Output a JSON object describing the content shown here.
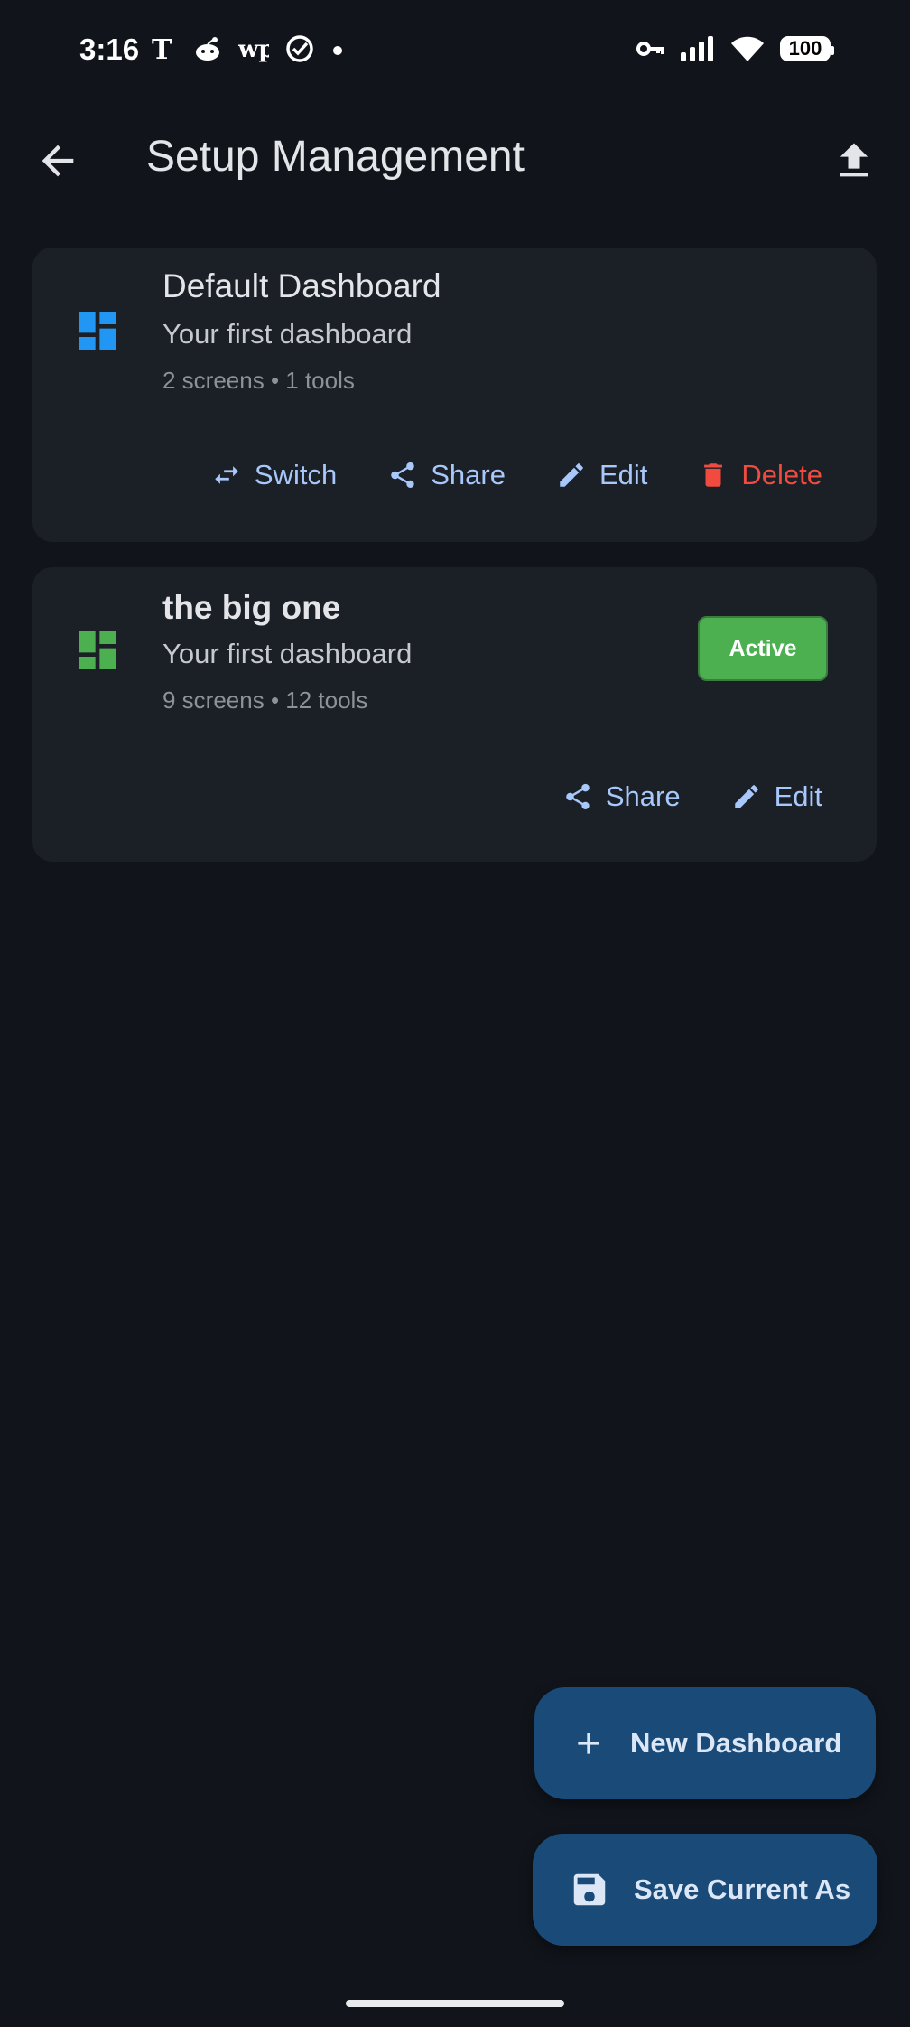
{
  "status_bar": {
    "time": "3:16",
    "left_icons": [
      "nyt-icon",
      "reddit-icon",
      "washington-post-icon",
      "check-circle-icon",
      "dot-icon"
    ],
    "right_icons": [
      "key-icon",
      "signal-icon",
      "wifi-icon"
    ],
    "battery": "100"
  },
  "app_bar": {
    "title": "Setup Management"
  },
  "dashboards": [
    {
      "name": "Default Dashboard",
      "description": "Your first dashboard",
      "meta": "2 screens • 1 tools",
      "icon_color": "#2196f3",
      "actions": {
        "switch": "Switch",
        "share": "Share",
        "edit": "Edit",
        "delete": "Delete"
      }
    },
    {
      "name": "the big one",
      "description": "Your first dashboard",
      "meta": "9 screens • 12 tools",
      "icon_color": "#4caf50",
      "badge": "Active",
      "actions": {
        "share": "Share",
        "edit": "Edit"
      }
    }
  ],
  "fabs": {
    "new_dashboard": "New Dashboard",
    "save_current_as": "Save Current As"
  },
  "colors": {
    "background": "#11151b",
    "card": "#1b1f26",
    "accent_text": "#a8c7fa",
    "delete": "#f04b3e",
    "active_badge": "#4caf50",
    "fab": "#1a4a78"
  }
}
